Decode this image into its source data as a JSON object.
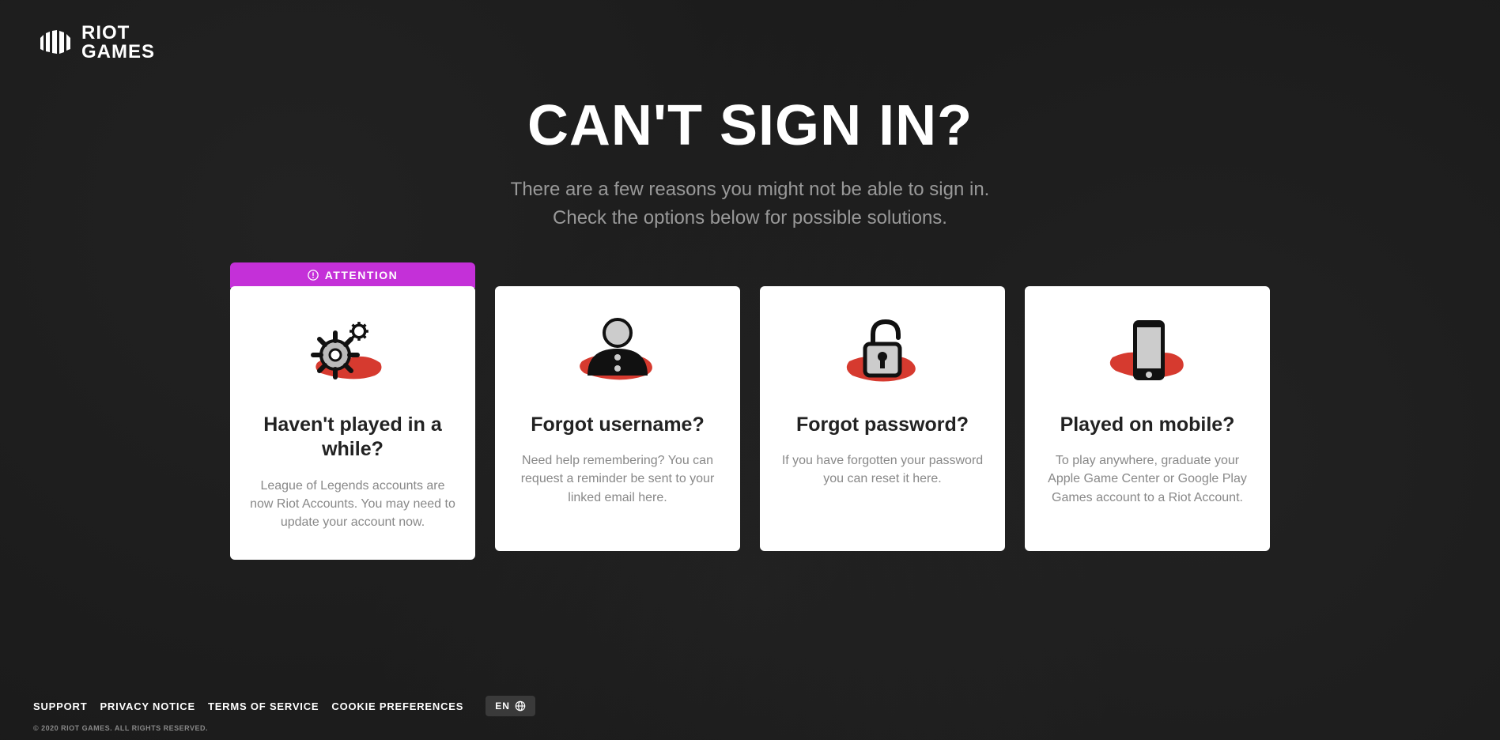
{
  "logo": {
    "line1": "RIOT",
    "line2": "GAMES"
  },
  "page": {
    "title": "CAN'T SIGN IN?",
    "subtitle_line1": "There are a few reasons you might not be able to sign in.",
    "subtitle_line2": "Check the options below for possible solutions."
  },
  "attention_label": "ATTENTION",
  "cards": [
    {
      "title": "Haven't played in a while?",
      "desc": "League of Legends accounts are now Riot Accounts. You may need to update your account now."
    },
    {
      "title": "Forgot username?",
      "desc": "Need help remembering? You can request a reminder be sent to your linked email here."
    },
    {
      "title": "Forgot password?",
      "desc": "If you have forgotten your password you can reset it here."
    },
    {
      "title": "Played on mobile?",
      "desc": "To play anywhere, graduate your Apple Game Center or Google Play Games account to a Riot Account."
    }
  ],
  "footer": {
    "links": [
      "SUPPORT",
      "PRIVACY NOTICE",
      "TERMS OF SERVICE",
      "COOKIE PREFERENCES"
    ],
    "lang": "EN",
    "copyright": "© 2020 RIOT GAMES. ALL RIGHTS RESERVED."
  }
}
